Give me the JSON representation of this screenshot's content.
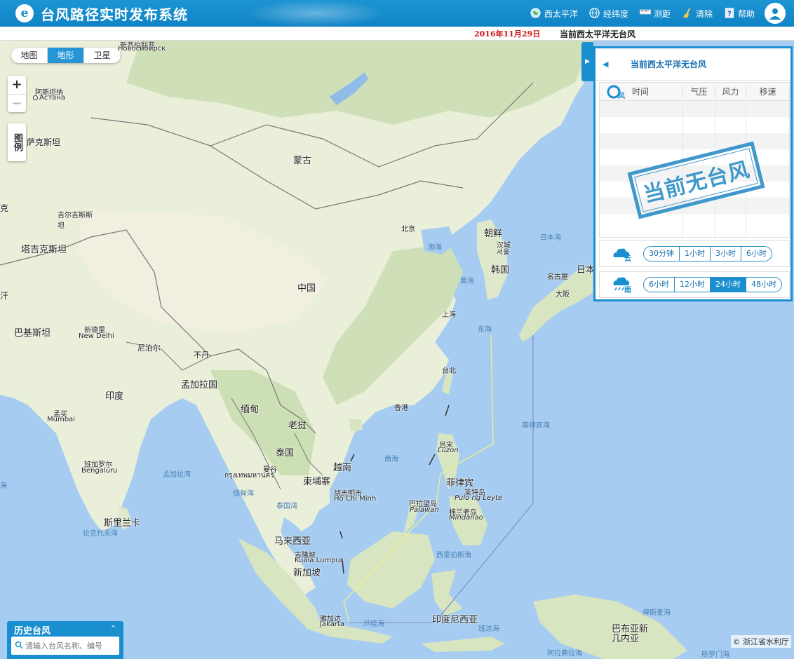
{
  "header": {
    "title": "台风路径实时发布系统",
    "logo_glyph": "e",
    "tools": [
      {
        "label": "西太平洋",
        "icon": "globe-icon"
      },
      {
        "label": "经纬度",
        "icon": "grid-globe-icon"
      },
      {
        "label": "测距",
        "icon": "ruler-icon"
      },
      {
        "label": "清除",
        "icon": "broom-icon"
      },
      {
        "label": "帮助",
        "icon": "help-icon"
      }
    ]
  },
  "subbar": {
    "date": "2016年11月29日",
    "status": "当前西太平洋无台风"
  },
  "map": {
    "types": [
      "地图",
      "地形",
      "卫星"
    ],
    "active_type": "地形",
    "zoom_in": "+",
    "zoom_out": "−",
    "legend": "图例",
    "labels": {
      "novosibirsk_cn": "新西伯利亚",
      "novosibirsk": "Новосибирск",
      "astana_cn": "阿斯坦纳",
      "astana": "Астана",
      "mongolia": "蒙古",
      "kazakh_edge": "萨克斯坦",
      "kyrgyz": "吉尔吉斯斯坦",
      "tajik": "塔吉克斯坦",
      "china": "中国",
      "beijing": "北京",
      "bohai": "渤海",
      "nkorea": "朝鲜",
      "seoul_cn": "汉城",
      "seoul": "서울",
      "skorea": "韩国",
      "yellowsea": "黄海",
      "japansea": "日本海",
      "japan": "日本",
      "nagoya": "名古屋",
      "osaka": "大阪",
      "shanghai": "上海",
      "eastsea": "东海",
      "taipei": "台北",
      "hongkong": "香港",
      "pakistan": "巴基斯坦",
      "newdelhi_cn": "新德里",
      "newdelhi": "New Delhi",
      "nepal": "尼泊尔",
      "bhutan": "不丹",
      "bangladesh": "孟加拉国",
      "india": "印度",
      "myanmar": "缅甸",
      "laos": "老挝",
      "thailand": "泰国",
      "vietnam": "越南",
      "cambodia": "柬埔寨",
      "mumbai_cn": "孟买",
      "mumbai": "Mumbai",
      "bengaluru_cn": "班加罗尔",
      "bengaluru": "Bengaluru",
      "bayofbengal": "孟加拉湾",
      "bangkok_cn": "曼谷",
      "bangkok": "กรุงเทพมหานคร",
      "hcm_cn": "胡志明市",
      "hcm": "Hồ Chí Minh",
      "andaman": "缅甸海",
      "gulfthai": "泰国湾",
      "srilanka": "斯里兰卡",
      "laccadive": "拉克代夫海",
      "malaysia": "马来西亚",
      "kl_cn": "吉隆坡",
      "kl": "Kuala Lumpur",
      "singapore": "新加坡",
      "southsea": "南海",
      "luzon_cn": "吕宋",
      "luzon": "Luzon",
      "philippines": "菲律宾",
      "leyte_cn": "莱特岛",
      "leyte": "Pulo ng Leyte",
      "palawan_cn": "巴拉望岛",
      "palawan": "Palawan",
      "mindanao_cn": "棉兰老岛",
      "mindanao": "Mindanao",
      "philsea": "菲律宾海",
      "celebes": "西里伯斯海",
      "java_sea": "爪哇海",
      "jakarta_cn": "雅加达",
      "jakarta": "Jakarta",
      "indonesia": "印度尼西亚",
      "banda": "班达海",
      "png": "巴布亚新几内亚",
      "bismarck": "俾斯麦海",
      "arafura": "阿拉弗拉海",
      "solomon": "所罗门海",
      "arabian": "海",
      "karachi_edge": "汗",
      "left_edge": "克"
    }
  },
  "panel": {
    "title": "当前西太平洋无台风",
    "table_icon_text": "风",
    "columns": [
      "时间",
      "气压",
      "风力",
      "移速"
    ],
    "stamp": "当前无台风",
    "cloud": {
      "icon_text": "云",
      "options": [
        "30分钟",
        "1小时",
        "3小时",
        "6小时"
      ],
      "active": null
    },
    "rain": {
      "icon_text": "雨",
      "options": [
        "6小时",
        "12小时",
        "24小时",
        "48小时"
      ],
      "active": "24小时"
    }
  },
  "history": {
    "title": "历史台风",
    "placeholder": "请输入台风名称、编号"
  },
  "copyright": "© 浙江省水利厅",
  "colors": {
    "brand": "#1a8fd0",
    "date_red": "#c81818",
    "ocean": "#a6cdf1",
    "land": "#e9eedb"
  }
}
